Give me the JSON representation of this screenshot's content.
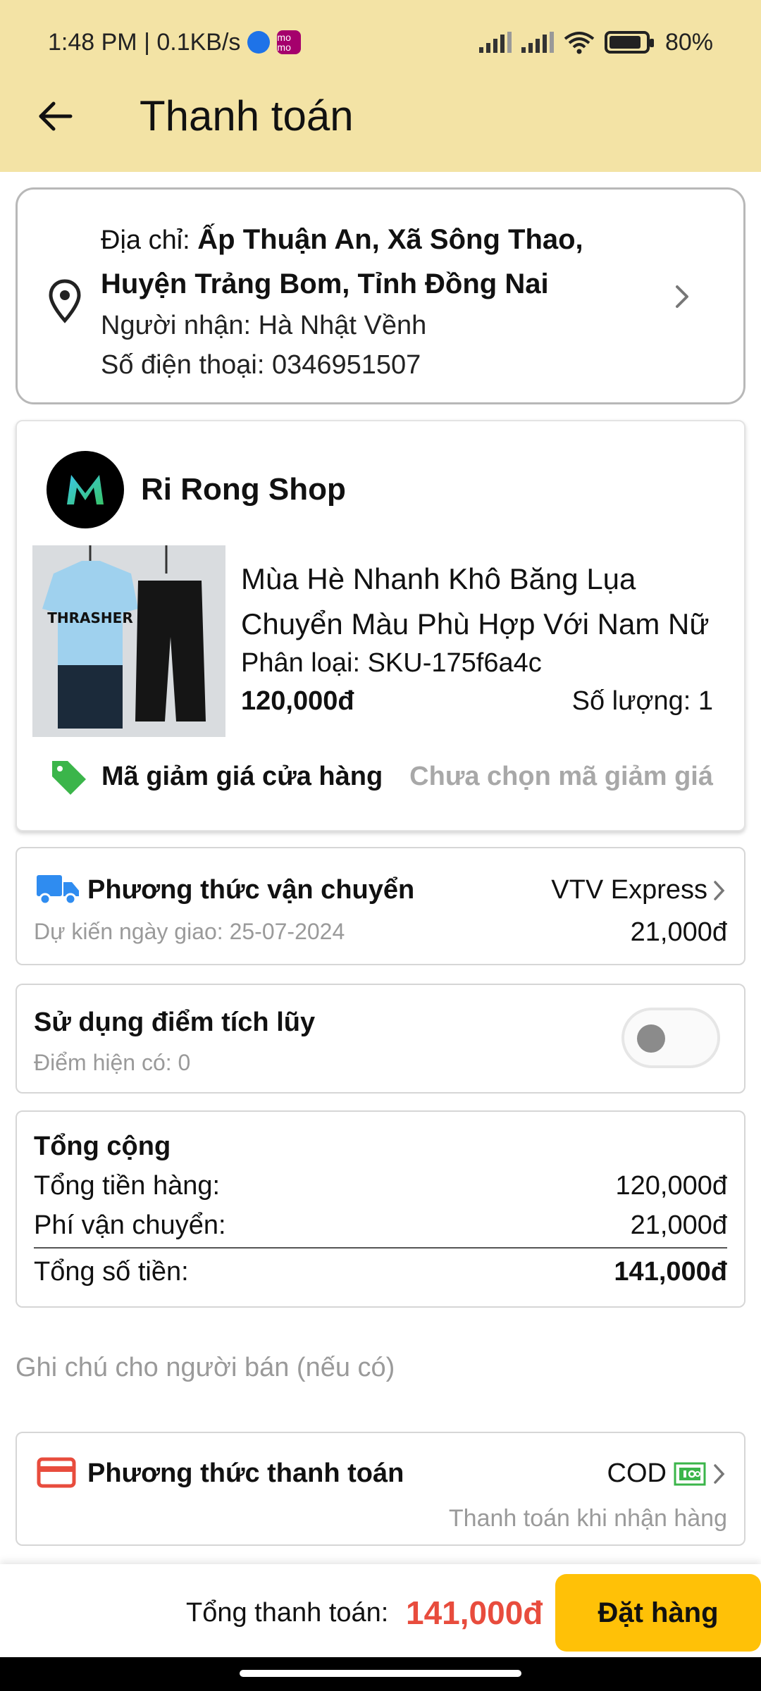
{
  "status_bar": {
    "time_net": "1:48 PM | 0.1KB/s",
    "momo_badge": "mo mo",
    "battery": "80%"
  },
  "header": {
    "title": "Thanh toán"
  },
  "address": {
    "prefix": "Địa chỉ: ",
    "line1": "Ấp Thuận An, Xã Sông Thao,",
    "line2": "Huyện Trảng Bom, Tỉnh Đồng Nai",
    "recipient": "Người nhận: Hà Nhật Vềnh",
    "phone": "Số điện thoại: 0346951507"
  },
  "shop": {
    "name": "Ri Rong Shop",
    "product_line1": "Mùa Hè Nhanh Khô Băng Lụa",
    "product_line2": "Chuyển Màu Phù Hợp Với Nam Nữ",
    "variant": "Phân loại: SKU-175f6a4c",
    "price": "120,000đ",
    "quantity": "Số lượng: 1",
    "voucher_label": "Mã giảm giá cửa hàng",
    "voucher_value": "Chưa chọn mã giảm giá",
    "product_print": "THRASHER"
  },
  "shipping": {
    "label": "Phương thức vận chuyển",
    "carrier": "VTV Express",
    "eta": "Dự kiến ngày giao: 25-07-2024",
    "fee": "21,000đ"
  },
  "points": {
    "label": "Sử dụng điểm tích lũy",
    "available": "Điểm hiện có: 0",
    "enabled": false
  },
  "total": {
    "heading": "Tổng cộng",
    "goods_label": "Tổng tiền hàng:",
    "goods_value": "120,000đ",
    "shipping_label": "Phí vận chuyển:",
    "shipping_value": "21,000đ",
    "sum_label": "Tổng số tiền:",
    "sum_value": "141,000đ"
  },
  "note": {
    "placeholder": "Ghi chú cho người bán (nếu có)"
  },
  "payment": {
    "label": "Phương thức thanh toán",
    "method": "COD",
    "description": "Thanh toán khi nhận hàng"
  },
  "bottom_bar": {
    "total_label": "Tổng thanh toán: ",
    "total_amount": "141,000đ",
    "order_button": "Đặt hàng"
  },
  "colors": {
    "header_bg": "#f3e3a5",
    "accent_red": "#e84c3d",
    "order_button": "#ffc107",
    "tag_green": "#3bb54a",
    "truck_blue": "#2f8cf0",
    "card_red": "#e84c3d"
  }
}
